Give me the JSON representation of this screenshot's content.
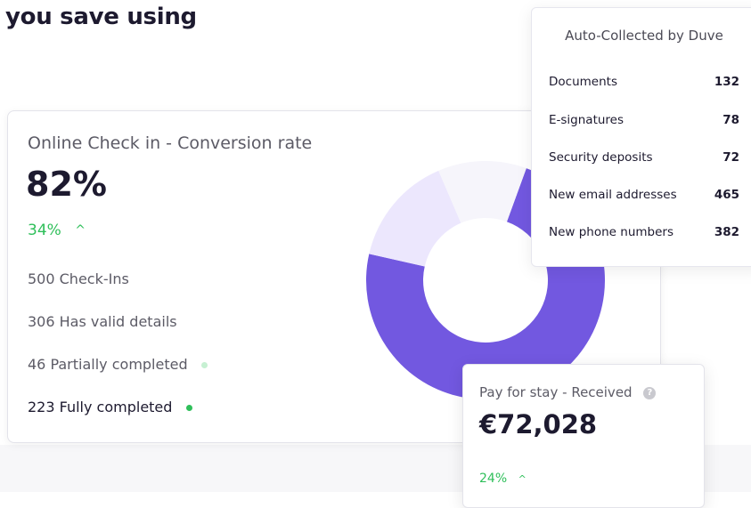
{
  "headline": "you save using",
  "conversion_card": {
    "title": "Online Check in - Conversion rate",
    "value": "82%",
    "change": "34%",
    "change_icon": "chevron-up-icon",
    "stats": [
      {
        "label": "500 Check-Ins"
      },
      {
        "label": "306 Has valid details"
      },
      {
        "label": "46 Partially completed",
        "dot_color": "#c6f0d2"
      },
      {
        "label": "223 Fully completed",
        "dot_color": "#2fbf5a"
      }
    ],
    "donut": [
      {
        "segment": "fully-completed",
        "fraction": 0.73,
        "color": "#7258e0"
      },
      {
        "segment": "partially-completed",
        "fraction": 0.15,
        "color": "#ece7fd"
      },
      {
        "segment": "remaining",
        "fraction": 0.12,
        "color": "#f6f5fb"
      }
    ]
  },
  "auto_collected": {
    "title": "Auto-Collected by Duve",
    "rows": [
      {
        "label": "Documents",
        "value": "132"
      },
      {
        "label": "E-signatures",
        "value": "78"
      },
      {
        "label": "Security deposits",
        "value": "72"
      },
      {
        "label": "New email addresses",
        "value": "465"
      },
      {
        "label": "New phone numbers",
        "value": "382"
      }
    ]
  },
  "pay_card": {
    "title": "Pay for stay - Received",
    "help_icon": "question-circle-icon",
    "value": "€72,028",
    "change": "24%",
    "change_icon": "chevron-up-icon"
  },
  "colors": {
    "accent": "#7258e0",
    "positive": "#2fbf5a"
  }
}
